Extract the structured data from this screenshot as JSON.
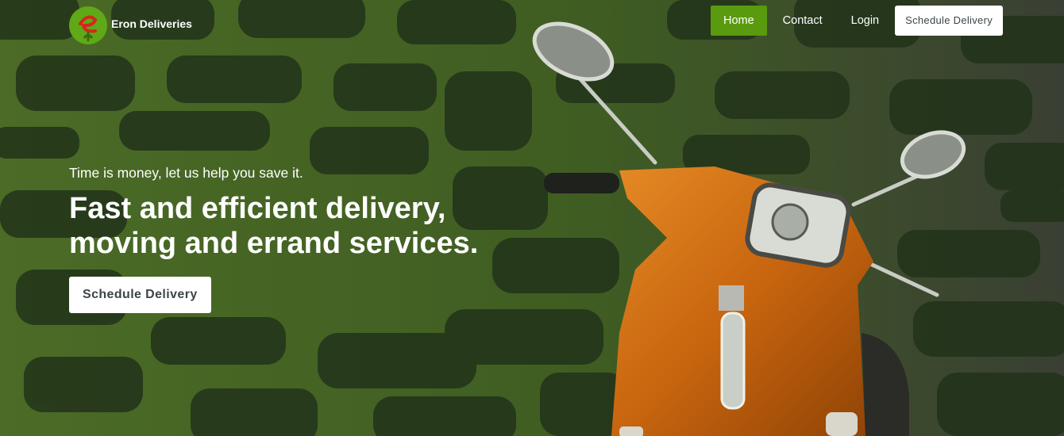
{
  "brand": {
    "name": "Eron Deliveries",
    "logo_letter": "e"
  },
  "nav": {
    "items": [
      {
        "label": "Home",
        "active": true
      },
      {
        "label": "Contact",
        "active": false
      },
      {
        "label": "Login",
        "active": false
      }
    ],
    "cta_label": "Schedule Delivery"
  },
  "hero": {
    "tagline": "Time is money, let us help you save it.",
    "headline_line1": "Fast and efficient delivery,",
    "headline_line2": "moving and errand services.",
    "cta_label": "Schedule Delivery",
    "background_image": "green-tinted stone wall with orange scooter"
  },
  "colors": {
    "accent": "#5a9a0e",
    "overlay": "#3d5a1c",
    "scooter": "#c96a12"
  }
}
